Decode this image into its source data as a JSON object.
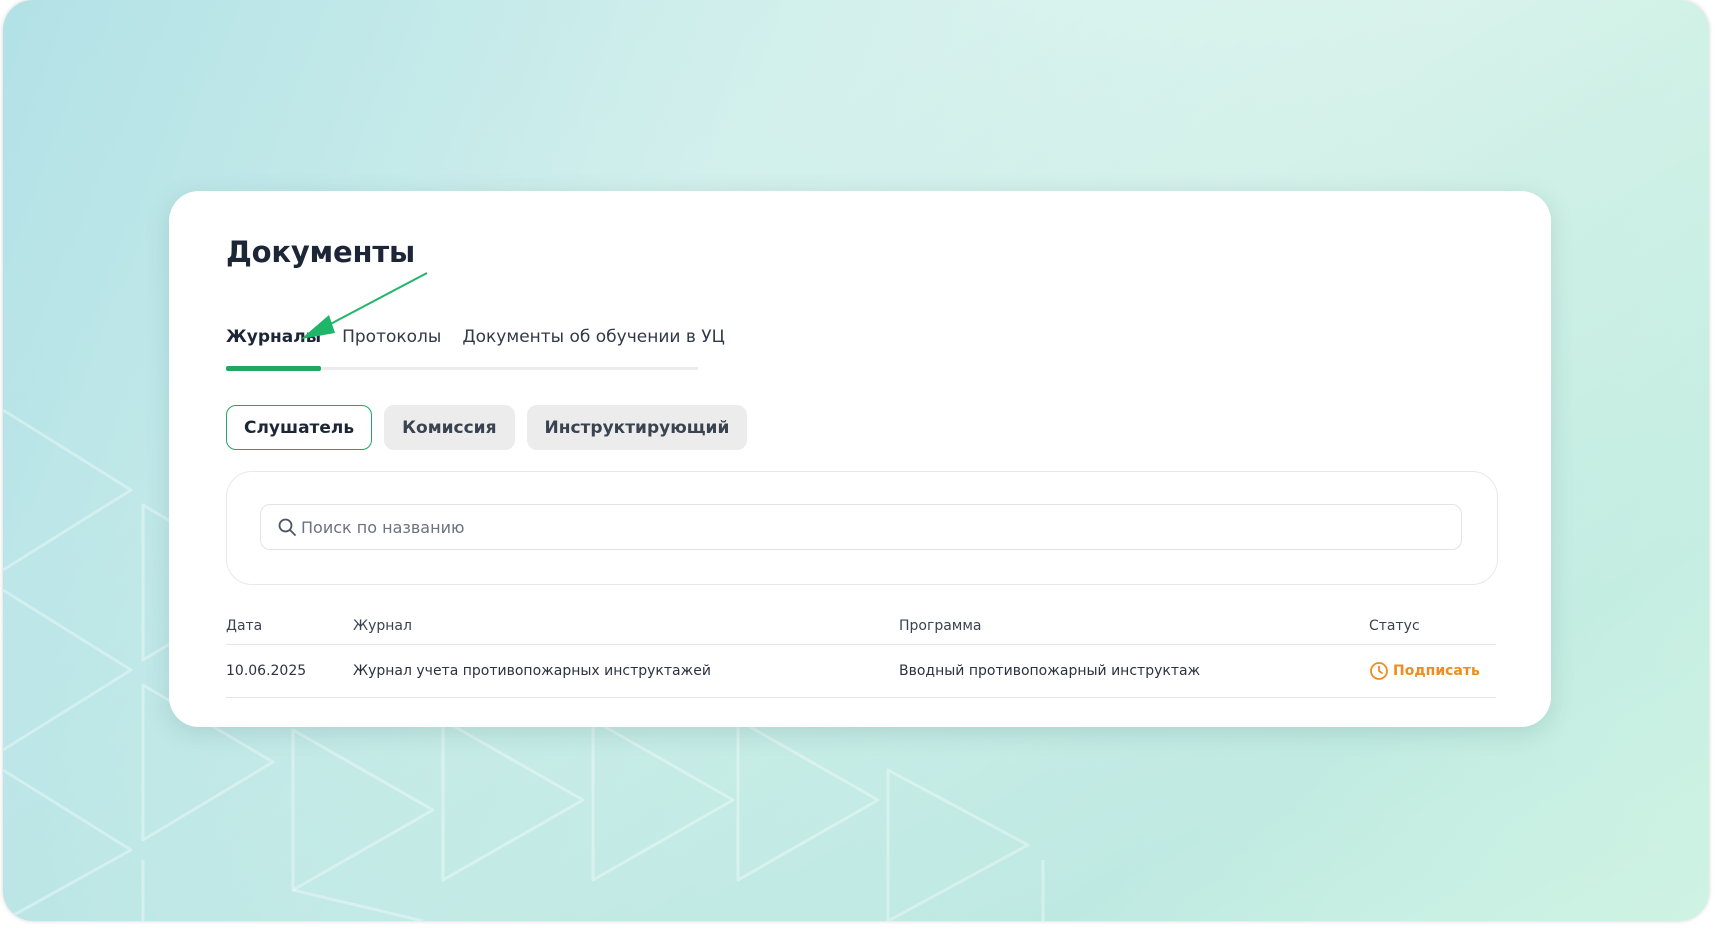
{
  "page": {
    "title": "Документы"
  },
  "tabs": [
    {
      "label": "Журналы",
      "active": true
    },
    {
      "label": "Протоколы",
      "active": false
    },
    {
      "label": "Документы об обучении в УЦ",
      "active": false
    }
  ],
  "roles": [
    {
      "label": "Слушатель",
      "active": true
    },
    {
      "label": "Комиссия",
      "active": false
    },
    {
      "label": "Инструктирующий",
      "active": false
    }
  ],
  "search": {
    "placeholder": "Поиск по названию",
    "value": "",
    "icon": "search-icon"
  },
  "table": {
    "headers": {
      "date": "Дата",
      "journal": "Журнал",
      "program": "Программа",
      "status": "Статус"
    },
    "rows": [
      {
        "date": "10.06.2025",
        "journal": "Журнал учета противопожарных инструктажей",
        "program": "Вводный противопожарный инструктаж",
        "status": "Подписать",
        "status_icon": "clock-icon"
      }
    ]
  },
  "colors": {
    "accent": "#1fa85f",
    "status_pending": "#f08c1e",
    "title": "#1d2636"
  }
}
